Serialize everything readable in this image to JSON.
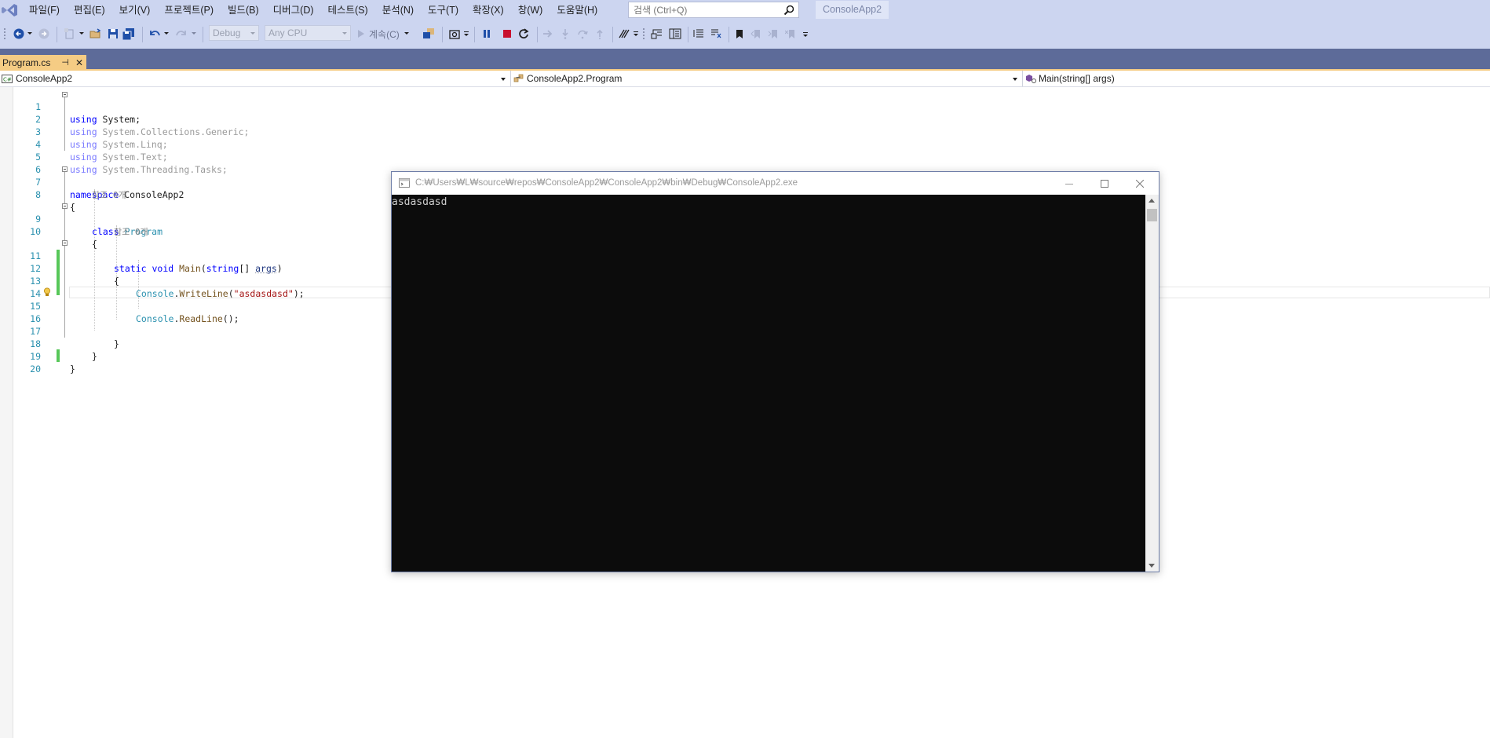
{
  "menubar": {
    "items": [
      "파일(F)",
      "편집(E)",
      "보기(V)",
      "프로젝트(P)",
      "빌드(B)",
      "디버그(D)",
      "테스트(S)",
      "분석(N)",
      "도구(T)",
      "확장(X)",
      "창(W)",
      "도움말(H)"
    ],
    "search_placeholder": "검색 (Ctrl+Q)",
    "solution_name": "ConsoleApp2"
  },
  "toolbar": {
    "config_value": "Debug",
    "platform_value": "Any CPU",
    "continue_label": "계속(C)"
  },
  "tabs": [
    {
      "label": "Program.cs",
      "pin": "⊣",
      "close": "✕",
      "active": true
    }
  ],
  "navbar": {
    "project": "ConsoleApp2",
    "class": "ConsoleApp2.Program",
    "member": "Main(string[] args)"
  },
  "editor": {
    "line_numbers": [
      "1",
      "2",
      "3",
      "4",
      "5",
      "6",
      "7",
      "8",
      "9",
      "10",
      "11",
      "12",
      "13",
      "14",
      "15",
      "16",
      "17",
      "18",
      "19",
      "20"
    ],
    "hints": [
      "참조 0개",
      "참조 0개"
    ],
    "code": {
      "l1_kw": "using",
      "l1_rest": " System;",
      "l2_kw": "using",
      "l2_rest": " System.Collections.Generic;",
      "l3_kw": "using",
      "l3_rest": " System.Linq;",
      "l4_kw": "using",
      "l4_rest": " System.Text;",
      "l5_kw": "using",
      "l5_rest": " System.Threading.Tasks;",
      "l7_kw": "namespace",
      "l7_rest": " ConsoleApp2",
      "l8": "{",
      "l9_kw": "class",
      "l9_type": "Program",
      "l10": "{",
      "l11_kw1": "static",
      "l11_kw2": "void",
      "l11_method": "Main",
      "l11_p1": "(",
      "l11_kw3": "string",
      "l11_p2": "[] ",
      "l11_param": "args",
      "l11_p3": ")",
      "l12": "{",
      "l13_type": "Console",
      "l13_dot": ".",
      "l13_method": "WriteLine",
      "l13_p1": "(",
      "l13_str": "\"asdasdasd\"",
      "l13_p2": ");",
      "l15_type": "Console",
      "l15_dot": ".",
      "l15_method": "ReadLine",
      "l15_p": "();",
      "l17": "}",
      "l18": "}",
      "l19": "}"
    }
  },
  "console": {
    "title": "C:₩Users₩L₩source₩repos₩ConsoleApp2₩ConsoleApp2₩bin₩Debug₩ConsoleApp2.exe",
    "output": "asdasdasd"
  }
}
